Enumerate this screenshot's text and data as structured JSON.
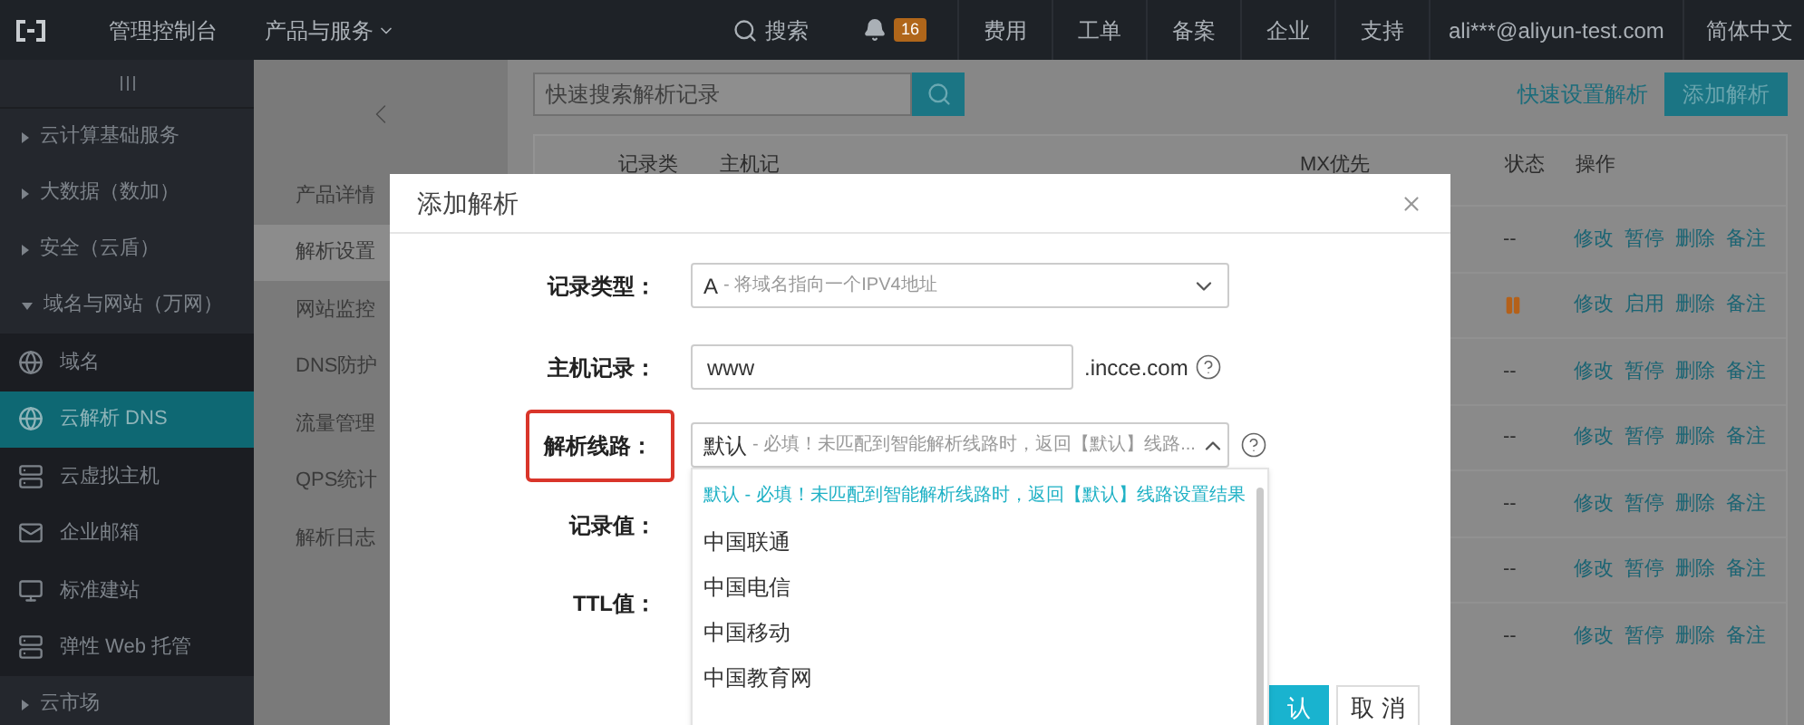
{
  "topbar": {
    "title": "管理控制台",
    "products": "产品与服务",
    "search": "搜索",
    "notifications": "16",
    "links": [
      "费用",
      "工单",
      "备案",
      "企业",
      "支持"
    ],
    "account": "ali***@aliyun-test.com",
    "language": "简体中文"
  },
  "sidebar": {
    "items": [
      {
        "label": "云计算基础服务",
        "expanded": false
      },
      {
        "label": "大数据（数加）",
        "expanded": false
      },
      {
        "label": "安全（云盾）",
        "expanded": false
      },
      {
        "label": "域名与网站（万网）",
        "expanded": true,
        "children": [
          {
            "label": "域名",
            "selected": false
          },
          {
            "label": "云解析 DNS",
            "selected": true
          },
          {
            "label": "云虚拟主机",
            "selected": false
          },
          {
            "label": "企业邮箱",
            "selected": false
          },
          {
            "label": "标准建站",
            "selected": false
          },
          {
            "label": "弹性 Web 托管",
            "selected": false
          }
        ]
      },
      {
        "label": "云市场",
        "expanded": false
      }
    ]
  },
  "subnav": {
    "items": [
      {
        "label": "产品详情",
        "selected": false
      },
      {
        "label": "解析设置",
        "selected": true
      },
      {
        "label": "网站监控",
        "selected": false
      },
      {
        "label": "DNS防护",
        "selected": false
      },
      {
        "label": "流量管理",
        "selected": false
      },
      {
        "label": "QPS统计",
        "selected": false
      },
      {
        "label": "解析日志",
        "selected": false
      }
    ]
  },
  "main": {
    "search": {
      "placeholder": "快速搜索解析记录"
    },
    "quick_link": "快速设置解析",
    "add_button": "添加解析",
    "table": {
      "columns": [
        "记录类",
        "主机记",
        "MX优先",
        "状态",
        "操作"
      ],
      "rows": [
        {
          "kind": "active",
          "status": "--",
          "actions": [
            "修改",
            "暂停",
            "删除",
            "备注"
          ]
        },
        {
          "kind": "paused",
          "actions": [
            "修改",
            "启用",
            "删除",
            "备注"
          ]
        },
        {
          "kind": "active",
          "status": "--",
          "actions": [
            "修改",
            "暂停",
            "删除",
            "备注"
          ]
        },
        {
          "kind": "active",
          "status": "--",
          "actions": [
            "修改",
            "暂停",
            "删除",
            "备注"
          ]
        },
        {
          "kind": "active",
          "status": "--",
          "actions": [
            "修改",
            "暂停",
            "删除",
            "备注"
          ]
        },
        {
          "kind": "active",
          "status": "--",
          "actions": [
            "修改",
            "暂停",
            "删除",
            "备注"
          ]
        },
        {
          "kind": "active",
          "status": "--",
          "actions": [
            "修改",
            "暂停",
            "删除",
            "备注"
          ]
        }
      ]
    }
  },
  "dialog": {
    "title": "添加解析",
    "fields": [
      {
        "label": "记录类型：",
        "kind": "select",
        "value": "A",
        "hint": " - 将域名指向一个IPV4地址",
        "open": false,
        "highlighted": false
      },
      {
        "label": "主机记录：",
        "kind": "input",
        "value": "www",
        "suffix": ".incce.com",
        "highlighted": false
      },
      {
        "label": "解析线路：",
        "kind": "select",
        "value": "默认",
        "hint": " - 必填！未匹配到智能解析线路时，返回【默认】线路...",
        "open": true,
        "highlighted": true
      },
      {
        "label": "记录值：",
        "kind": "blank",
        "highlighted": false
      },
      {
        "label": "TTL值：",
        "kind": "blank",
        "highlighted": false
      }
    ],
    "options": [
      {
        "label": "默认 - 必填！未匹配到智能解析线路时，返回【默认】线路设置结果",
        "selected": true
      },
      {
        "label": "中国联通",
        "selected": false
      },
      {
        "label": "中国电信",
        "selected": false
      },
      {
        "label": "中国移动",
        "selected": false
      },
      {
        "label": "中国教育网",
        "selected": false
      }
    ],
    "buttons": [
      {
        "label": "认",
        "kind": "primary"
      },
      {
        "label": "取 消",
        "kind": "default"
      }
    ]
  }
}
